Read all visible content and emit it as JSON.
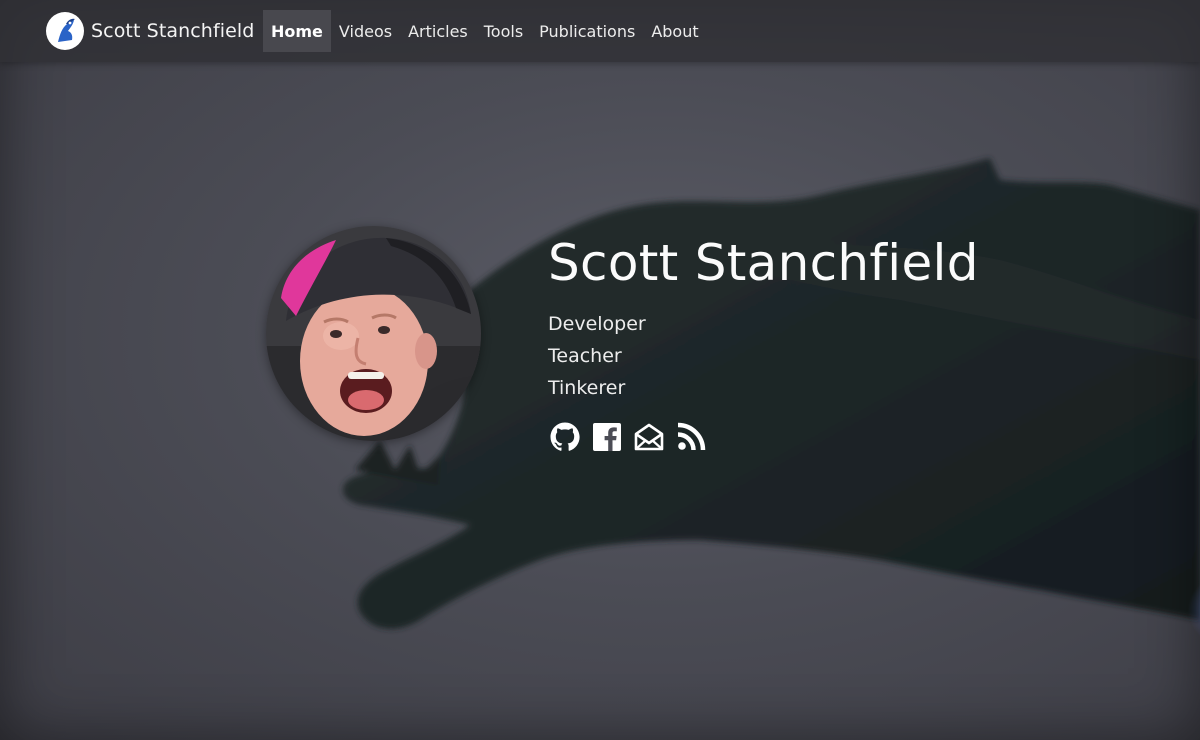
{
  "header": {
    "brand": "Scott Stanchfield",
    "nav": [
      {
        "label": "Home",
        "active": true
      },
      {
        "label": "Videos",
        "active": false
      },
      {
        "label": "Articles",
        "active": false
      },
      {
        "label": "Tools",
        "active": false
      },
      {
        "label": "Publications",
        "active": false
      },
      {
        "label": "About",
        "active": false
      }
    ]
  },
  "profile": {
    "name": "Scott Stanchfield",
    "roles": [
      "Developer",
      "Teacher",
      "Tinkerer"
    ]
  },
  "social": [
    {
      "icon": "github-icon"
    },
    {
      "icon": "facebook-icon"
    },
    {
      "icon": "envelope-open-icon"
    },
    {
      "icon": "rss-icon"
    }
  ],
  "colors": {
    "navbar_bg": "#303034",
    "active_tab_bg": "#48484e",
    "hero_bg": "#4b4c55",
    "text": "#ffffff"
  }
}
